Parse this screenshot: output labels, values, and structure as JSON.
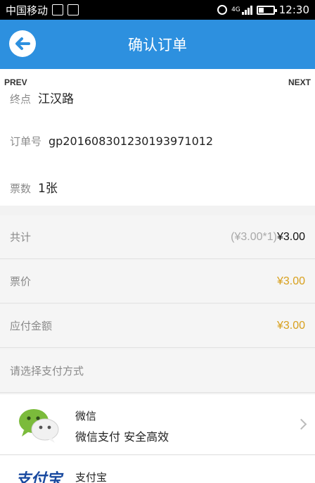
{
  "status_bar": {
    "carrier": "中国移动",
    "network_type": "4G",
    "time": "12:30"
  },
  "header": {
    "title": "确认订单"
  },
  "pager": {
    "prev": "PREV",
    "next": "NEXT"
  },
  "order": {
    "destination_label": "终点",
    "destination_value": "江汉路",
    "order_no_label": "订单号",
    "order_no_value": "gp20160830123019397101​2",
    "tickets_label": "票数",
    "tickets_value": "1张"
  },
  "amounts": {
    "total_label": "共计",
    "total_detail": "(¥3.00*1)",
    "total_value": "¥3.00",
    "price_label": "票价",
    "price_value": "¥3.00",
    "payable_label": "应付金额",
    "payable_value": "¥3.00"
  },
  "payment": {
    "section_label": "请选择支付方式",
    "methods": [
      {
        "name": "微信",
        "desc": "微信支付 安全高效",
        "icon": "wechat-icon"
      },
      {
        "name": "支付宝",
        "desc": "",
        "icon": "alipay-icon"
      }
    ],
    "alipay_logo_text": "支付宝"
  },
  "colors": {
    "header_blue": "#2d90df",
    "amount_gold": "#d8a01d",
    "wechat_green": "#7bbb3b"
  }
}
